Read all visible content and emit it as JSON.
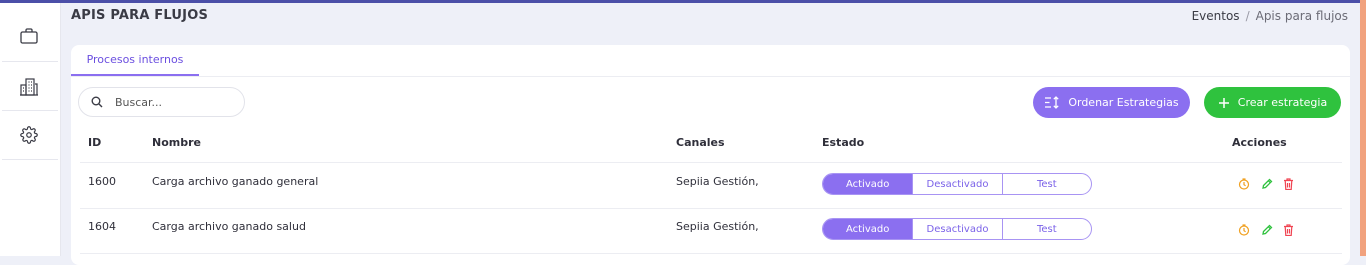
{
  "header": {
    "title": "APIS PARA FLUJOS",
    "breadcrumb": {
      "parent": "Eventos",
      "separator": "/",
      "current": "Apis para flujos"
    }
  },
  "sidebar": {
    "items": [
      {
        "icon": "briefcase-icon"
      },
      {
        "icon": "building-icon"
      },
      {
        "icon": "gear-icon"
      }
    ]
  },
  "tabs": [
    {
      "label": "Procesos internos",
      "active": true
    }
  ],
  "search": {
    "placeholder": "Buscar..."
  },
  "toolbar": {
    "order_label": "Ordenar Estrategias",
    "create_label": "Crear estrategia"
  },
  "table": {
    "columns": [
      "ID",
      "Nombre",
      "Canales",
      "Estado",
      "Acciones"
    ],
    "rows": [
      {
        "id": "1600",
        "name": "Carga archivo ganado general",
        "channels": "Sepiia Gestión,",
        "status_options": [
          "Activado",
          "Desactivado",
          "Test"
        ],
        "status": "Activado"
      },
      {
        "id": "1604",
        "name": "Carga archivo ganado salud",
        "channels": "Sepiia Gestión,",
        "status_options": [
          "Activado",
          "Desactivado",
          "Test"
        ],
        "status": "Activado"
      }
    ]
  },
  "colors": {
    "accent": "#8b6ff0",
    "create": "#2fc23e",
    "history_icon": "#f0a020",
    "edit_icon": "#2fc23e",
    "delete_icon": "#f04452"
  }
}
